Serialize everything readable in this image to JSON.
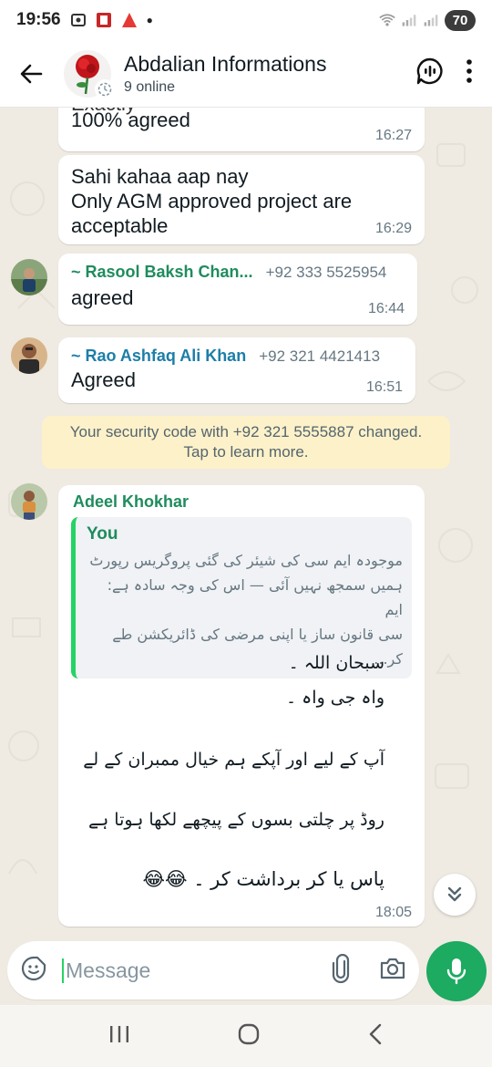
{
  "status_bar": {
    "time": "19:56",
    "battery": "70"
  },
  "header": {
    "title": "Abdalian Informations",
    "subtitle": "9 online"
  },
  "messages": [
    {
      "partial_text": "Exactly",
      "text": "100% agreed",
      "time": "16:27"
    },
    {
      "lines": [
        "Sahi kahaa aap nay",
        "Only AGM approved project are",
        "acceptable"
      ],
      "time": "16:29"
    },
    {
      "sender": "~ Rasool Baksh Chan...",
      "phone": "+92 333 5525954",
      "text": "agreed",
      "time": "16:44"
    },
    {
      "sender": "~ Rao Ashfaq Ali Khan",
      "phone": "+92 321 4421413",
      "text": "Agreed",
      "time": "16:51"
    }
  ],
  "system_note": {
    "line1": "Your security code with +92 321 5555887 changed.",
    "line2": "Tap to learn more."
  },
  "reply_message": {
    "sender": "Adeel Khokhar",
    "quote_author": "You",
    "quote_lines": [
      "موجودہ ایم سی کی شیئر کی گئی پروگریس رپورٹ",
      "ہمیں سمجھ نہیں آئی — اس کی وجہ سادہ ہے: ایم",
      "سی قانون ساز یا اپنی مرضی کی ڈائریکشن طے کر..."
    ],
    "body_lines": [
      "سبحان اللہ ۔",
      "واہ جی واہ ۔",
      "آپ کے لیے اور آپکے ہم خیال ممبران کے لے",
      "روڈ پر چلتی بسوں کے پیچھے  لکھا ہوتا ہے",
      "پاس یا کر برداشت کر ۔ 😂😂"
    ],
    "time": "18:05"
  },
  "composer": {
    "placeholder": "Message"
  },
  "colors": {
    "accent": "#1daa61",
    "chat_bg": "#efeae2",
    "sender_green": "#1f8c5e",
    "sender_teal": "#1d7ea8"
  }
}
